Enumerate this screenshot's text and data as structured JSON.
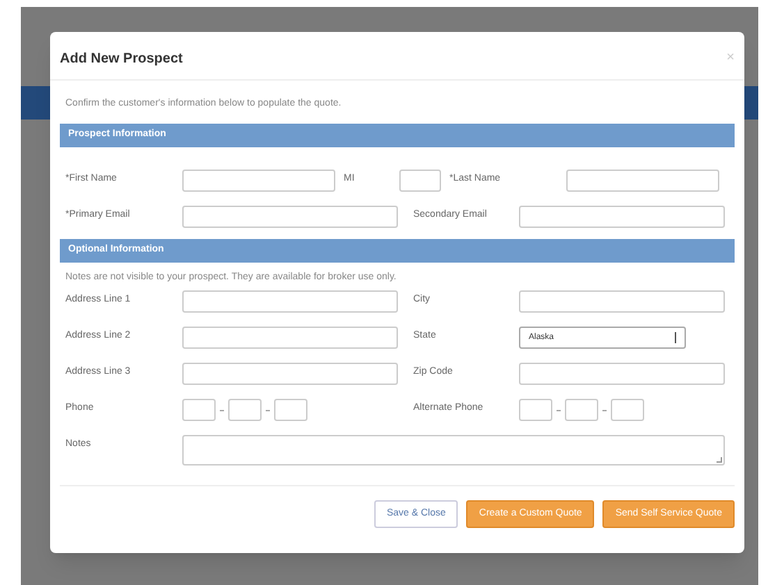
{
  "dialog": {
    "title": "Add New Prospect",
    "close": "×",
    "intro": "Confirm the customer's information below to populate the quote.",
    "sections": [
      {
        "heading": "Prospect Information",
        "rows": [
          {
            "fields": [
              {
                "label": "*First Name",
                "kind": "text"
              },
              {
                "label": "MI",
                "kind": "short"
              },
              {
                "label": "*Last Name",
                "kind": "text"
              }
            ]
          },
          {
            "fields": [
              {
                "label": "*Primary Email",
                "kind": "text"
              },
              {
                "label": "Secondary Email",
                "kind": "text"
              }
            ]
          }
        ]
      },
      {
        "heading": "Optional Information",
        "note": "Notes are not visible to your prospect. They are available for broker use only.",
        "rows": [
          {
            "fields": [
              {
                "label": "Address Line 1",
                "kind": "text"
              },
              {
                "label": "City",
                "kind": "text"
              }
            ]
          },
          {
            "fields": [
              {
                "label": "Address Line 2",
                "kind": "text"
              },
              {
                "label": "State",
                "kind": "select",
                "value": "Alaska"
              }
            ]
          },
          {
            "fields": [
              {
                "label": "Address Line 3",
                "kind": "text"
              },
              {
                "label": "Zip Code",
                "kind": "text"
              }
            ]
          },
          {
            "fields": [
              {
                "label": "Phone",
                "kind": "phone"
              },
              {
                "label": "Alternate Phone",
                "kind": "phone"
              }
            ]
          },
          {
            "fields": [
              {
                "label": "Notes",
                "kind": "textarea"
              }
            ]
          }
        ]
      }
    ],
    "buttons": [
      {
        "label": "Save & Close",
        "kind": "secondary"
      },
      {
        "label": "Create a Custom Quote",
        "kind": "primary"
      },
      {
        "label": "Send Self Service Quote",
        "kind": "primary"
      }
    ]
  }
}
